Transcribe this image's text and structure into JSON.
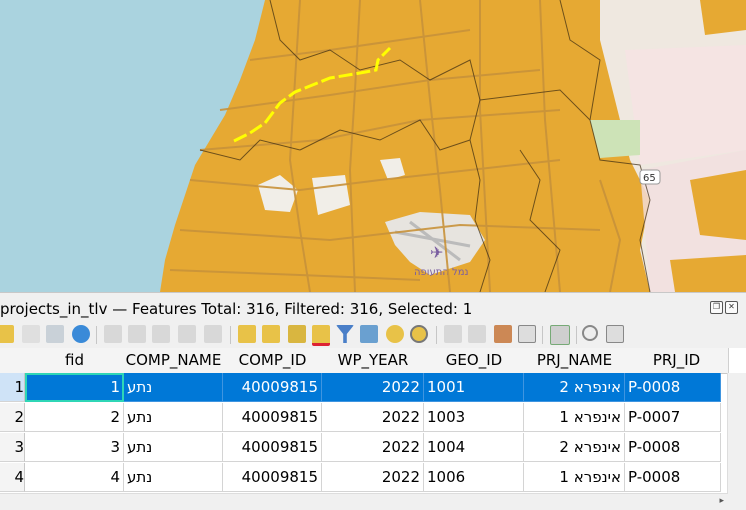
{
  "map": {
    "colors": {
      "fill": "#e6a933",
      "road": "#c8923a",
      "sea": "#aad3df",
      "highlight": "#ffff00"
    },
    "labels": {
      "route_shield": "65",
      "airport_label": "נמל התעופה"
    }
  },
  "attribute_table": {
    "title": "projects_in_tlv — Features Total: 316, Filtered: 316, Selected: 1",
    "window_controls": [
      "restore-icon",
      "close-icon"
    ],
    "toolbar_icons": [
      "edit-pencil-icon",
      "multi-edit-icon",
      "save-edits-icon",
      "reload-icon",
      "add-feature-icon",
      "delete-feature-icon",
      "cut-icon",
      "copy-icon",
      "paste-icon",
      "select-by-expression-icon",
      "select-all-icon",
      "invert-selection-icon",
      "deselect-all-icon",
      "filter-select-icon",
      "move-selection-top-icon",
      "pan-to-selection-icon",
      "zoom-to-selection-icon",
      "new-field-icon",
      "delete-field-icon",
      "open-field-calculator-icon",
      "conditional-formatting-icon",
      "actions-icon",
      "dock-icon",
      "table-view-icon"
    ],
    "columns": [
      "fid",
      "COMP_NAME",
      "COMP_ID",
      "WP_YEAR",
      "GEO_ID",
      "PRJ_NAME",
      "PRJ_ID"
    ],
    "row_numbers": [
      "1",
      "2",
      "3",
      "4"
    ],
    "rows": [
      {
        "fid": "1",
        "COMP_NAME": "נתע",
        "COMP_ID": "40009815",
        "WP_YEAR": "2022",
        "GEO_ID": "1001",
        "PRJ_NAME": "אינפרא 2",
        "PRJ_ID": "P-0008",
        "selected": true
      },
      {
        "fid": "2",
        "COMP_NAME": "נתע",
        "COMP_ID": "40009815",
        "WP_YEAR": "2022",
        "GEO_ID": "1003",
        "PRJ_NAME": "אינפרא 1",
        "PRJ_ID": "P-0007",
        "selected": false
      },
      {
        "fid": "3",
        "COMP_NAME": "נתע",
        "COMP_ID": "40009815",
        "WP_YEAR": "2022",
        "GEO_ID": "1004",
        "PRJ_NAME": "אינפרא 2",
        "PRJ_ID": "P-0008",
        "selected": false
      },
      {
        "fid": "4",
        "COMP_NAME": "נתע",
        "COMP_ID": "40009815",
        "WP_YEAR": "2022",
        "GEO_ID": "1006",
        "PRJ_NAME": "אינפרא 1",
        "PRJ_ID": "P-0008",
        "selected": false
      }
    ],
    "colors": {
      "selected_row": "#0078d7",
      "current_cell": "#2fd6b6"
    }
  }
}
